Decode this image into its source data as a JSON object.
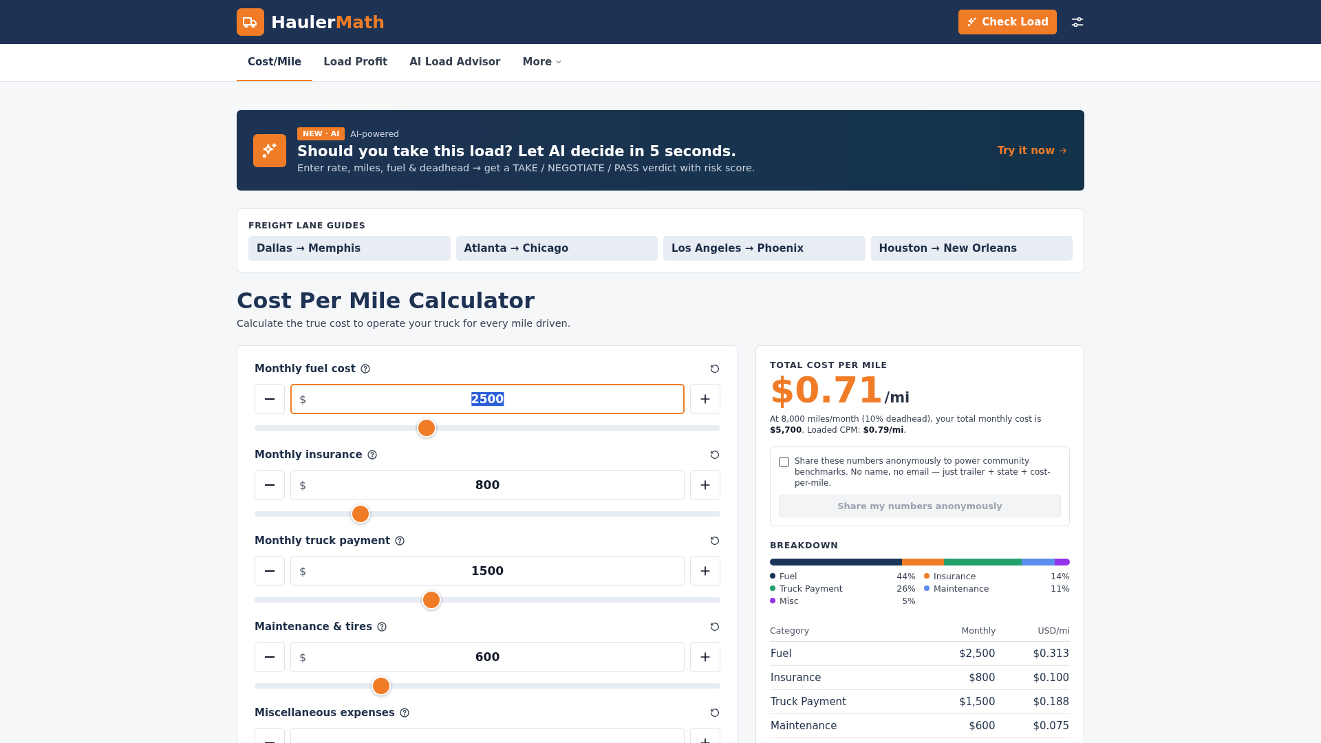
{
  "header": {
    "brand_first": "Hauler",
    "brand_second": "Math",
    "action": "Check Load"
  },
  "nav": {
    "tabs": [
      {
        "label": "Cost/Mile",
        "selected": true,
        "kind": "tab"
      },
      {
        "label": "Load Profit",
        "selected": false,
        "kind": "tab"
      },
      {
        "label": "AI Load Advisor",
        "selected": false,
        "kind": "tab"
      },
      {
        "label": "More",
        "selected": false,
        "kind": "dropdown"
      }
    ]
  },
  "banner": {
    "badge": "NEW · AI",
    "tag": "AI-powered",
    "title": "Should you take this load? Let AI decide in 5 seconds.",
    "subtitle": "Enter rate, miles, fuel & deadhead → get a TAKE / NEGOTIATE / PASS verdict with risk score.",
    "link": "Try it now"
  },
  "lane_guides": {
    "heading": "FREIGHT LANE GUIDES",
    "lanes": [
      "Dallas → Memphis",
      "Atlanta → Chicago",
      "Los Angeles → Phoenix",
      "Houston → New Orleans"
    ]
  },
  "page": {
    "title": "Cost Per Mile Calculator",
    "subtitle": "Calculate the true cost to operate your truck for every mile driven."
  },
  "calculator": {
    "fields": [
      {
        "label": "Monthly fuel cost",
        "prefix": "$",
        "value": "2500",
        "level": 0.37,
        "focused": true
      },
      {
        "label": "Monthly insurance",
        "prefix": "$",
        "value": "800",
        "level": 0.227,
        "focused": false
      },
      {
        "label": "Monthly truck payment",
        "prefix": "$",
        "value": "1500",
        "level": 0.38,
        "focused": false
      },
      {
        "label": "Maintenance & tires",
        "prefix": "$",
        "value": "600",
        "level": 0.272,
        "focused": false
      },
      {
        "label": "Miscellaneous expenses",
        "focused": false
      }
    ]
  },
  "results": {
    "heading": "TOTAL COST PER MILE",
    "amount": "$0.71",
    "unit": "/mi",
    "summary": "At 8,000 miles/month (10% deadhead), your total monthly cost is **$5,700**. Loaded CPM: **$0.79/mi**.",
    "share": {
      "text": "Share these numbers anonymously to power community benchmarks. No name, no email — just trailer + state + cost-per-mile.",
      "checked": false,
      "button": "Share my numbers anonymously",
      "disabled": true
    },
    "breakdown": {
      "heading": "BREAKDOWN",
      "segments": [
        {
          "name": "Fuel",
          "percent": "44%",
          "color": "#1b3558"
        },
        {
          "name": "Insurance",
          "percent": "14%",
          "color": "#f07c27"
        },
        {
          "name": "Truck Payment",
          "percent": "26%",
          "color": "#22a06b"
        },
        {
          "name": "Maintenance",
          "percent": "11%",
          "color": "#5b8def"
        },
        {
          "name": "Misc",
          "percent": "5%",
          "color": "#9333ea"
        }
      ]
    },
    "table": {
      "columns": [
        "Category",
        "Monthly",
        "USD/mi"
      ],
      "rows": [
        [
          "Fuel",
          "$2,500",
          "$0.313"
        ],
        [
          "Insurance",
          "$800",
          "$0.100"
        ],
        [
          "Truck Payment",
          "$1,500",
          "$0.188"
        ],
        [
          "Maintenance",
          "$600",
          "$0.075"
        ]
      ]
    }
  }
}
